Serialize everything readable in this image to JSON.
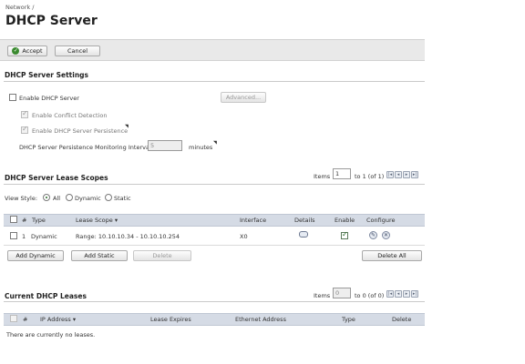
{
  "breadcrumb": "Network /",
  "page_title": "DHCP Server",
  "toolbar": {
    "accept_label": "Accept",
    "cancel_label": "Cancel"
  },
  "settings": {
    "title": "DHCP Server Settings",
    "enable_label": "Enable DHCP Server",
    "enable_checked": false,
    "advanced_label": "Advanced...",
    "conflict_label": "Enable Conflict Detection",
    "conflict_checked": true,
    "persistence_label": "Enable DHCP Server Persistence",
    "persistence_checked": true,
    "interval_label": "DHCP Server Persistence Monitoring Interval:",
    "interval_value": "5",
    "interval_unit": "minutes"
  },
  "scopes": {
    "title": "DHCP Server Lease Scopes",
    "items_label": "Items",
    "items_value": "1",
    "range_text": "to 1 (of 1)",
    "view_style_label": "View Style:",
    "view_options": [
      "All",
      "Dynamic",
      "Static"
    ],
    "view_selected": "All",
    "columns": [
      "#",
      "Type",
      "Lease Scope",
      "Interface",
      "Details",
      "Enable",
      "Configure"
    ],
    "rows": [
      {
        "num": "1",
        "type": "Dynamic",
        "scope": "Range: 10.10.10.34 - 10.10.10.254",
        "interface": "X0",
        "enabled": true
      }
    ],
    "buttons": {
      "add_dynamic": "Add Dynamic",
      "add_static": "Add Static",
      "delete": "Delete",
      "delete_all": "Delete All"
    }
  },
  "leases": {
    "title": "Current DHCP Leases",
    "items_label": "Items",
    "items_value": "0",
    "range_text": "to 0 (of 0)",
    "columns": [
      "#",
      "IP Address",
      "Lease Expires",
      "Ethernet Address",
      "Type",
      "Delete"
    ],
    "empty_text": "There are currently no leases."
  }
}
